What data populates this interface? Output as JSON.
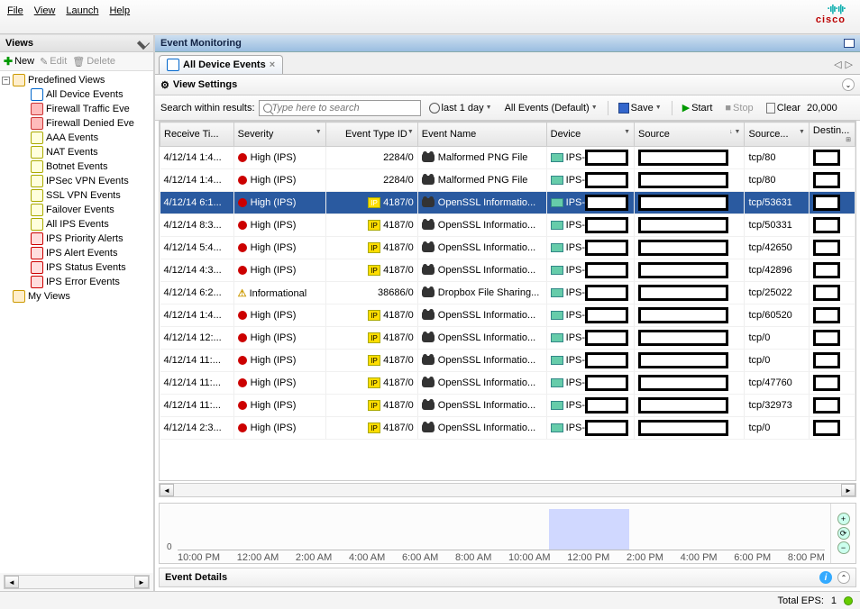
{
  "menu": {
    "file": "File",
    "view": "View",
    "launch": "Launch",
    "help": "Help"
  },
  "brand": {
    "name": "cisco"
  },
  "views": {
    "title": "Views",
    "new": "New",
    "edit": "Edit",
    "delete": "Delete",
    "predefined": "Predefined Views",
    "items": [
      "All Device Events",
      "Firewall Traffic Eve",
      "Firewall Denied Eve",
      "AAA Events",
      "NAT Events",
      "Botnet Events",
      "IPSec VPN Events",
      "SSL VPN Events",
      "Failover Events",
      "All IPS Events",
      "IPS Priority Alerts",
      "IPS Alert Events",
      "IPS Status Events",
      "IPS Error Events"
    ],
    "myviews": "My Views"
  },
  "right": {
    "title": "Event Monitoring",
    "tab": "All Device Events",
    "viewsettings": "View Settings",
    "search_label": "Search within results:",
    "search_placeholder": "Type here to search",
    "last": "last 1 day",
    "filter": "All Events (Default)",
    "save": "Save",
    "start": "Start",
    "stop": "Stop",
    "clear": "Clear",
    "clear_count": "20,000"
  },
  "cols": {
    "receive": "Receive Ti...",
    "severity": "Severity",
    "etype": "Event Type ID",
    "ename": "Event Name",
    "device": "Device",
    "source": "Source",
    "sservice": "Source...",
    "dest": "Destin..."
  },
  "rows": [
    {
      "t": "4/12/14 1:4...",
      "sev": "High (IPS)",
      "eid": "2284/0",
      "en": "Malformed PNG File",
      "dv": "IPS-",
      "ss": "tcp/80",
      "sel": false,
      "badge": false
    },
    {
      "t": "4/12/14 1:4...",
      "sev": "High (IPS)",
      "eid": "2284/0",
      "en": "Malformed PNG File",
      "dv": "IPS-",
      "ss": "tcp/80",
      "sel": false,
      "badge": false
    },
    {
      "t": "4/12/14 6:1...",
      "sev": "High (IPS)",
      "eid": "4187/0",
      "en": "OpenSSL Informatio...",
      "dv": "IPS-",
      "ss": "tcp/53631",
      "sel": true,
      "badge": true
    },
    {
      "t": "4/12/14 8:3...",
      "sev": "High (IPS)",
      "eid": "4187/0",
      "en": "OpenSSL Informatio...",
      "dv": "IPS-",
      "ss": "tcp/50331",
      "sel": false,
      "badge": true
    },
    {
      "t": "4/12/14 5:4...",
      "sev": "High (IPS)",
      "eid": "4187/0",
      "en": "OpenSSL Informatio...",
      "dv": "IPS-",
      "ss": "tcp/42650",
      "sel": false,
      "badge": true
    },
    {
      "t": "4/12/14 4:3...",
      "sev": "High (IPS)",
      "eid": "4187/0",
      "en": "OpenSSL Informatio...",
      "dv": "IPS-",
      "ss": "tcp/42896",
      "sel": false,
      "badge": true
    },
    {
      "t": "4/12/14 6:2...",
      "sev": "Informational",
      "eid": "38686/0",
      "en": "Dropbox File Sharing...",
      "dv": "IPS-",
      "ss": "tcp/25022",
      "sel": false,
      "badge": false,
      "info": true
    },
    {
      "t": "4/12/14 1:4...",
      "sev": "High (IPS)",
      "eid": "4187/0",
      "en": "OpenSSL Informatio...",
      "dv": "IPS-",
      "ss": "tcp/60520",
      "sel": false,
      "badge": true
    },
    {
      "t": "4/12/14 12:...",
      "sev": "High (IPS)",
      "eid": "4187/0",
      "en": "OpenSSL Informatio...",
      "dv": "IPS-",
      "ss": "tcp/0",
      "sel": false,
      "badge": true
    },
    {
      "t": "4/12/14 11:...",
      "sev": "High (IPS)",
      "eid": "4187/0",
      "en": "OpenSSL Informatio...",
      "dv": "IPS-",
      "ss": "tcp/0",
      "sel": false,
      "badge": true
    },
    {
      "t": "4/12/14 11:...",
      "sev": "High (IPS)",
      "eid": "4187/0",
      "en": "OpenSSL Informatio...",
      "dv": "IPS-",
      "ss": "tcp/47760",
      "sel": false,
      "badge": true
    },
    {
      "t": "4/12/14 11:...",
      "sev": "High (IPS)",
      "eid": "4187/0",
      "en": "OpenSSL Informatio...",
      "dv": "IPS-",
      "ss": "tcp/32973",
      "sel": false,
      "badge": true
    },
    {
      "t": "4/12/14 2:3...",
      "sev": "High (IPS)",
      "eid": "4187/0",
      "en": "OpenSSL Informatio...",
      "dv": "IPS-",
      "ss": "tcp/0",
      "sel": false,
      "badge": true
    }
  ],
  "timeline": {
    "labels": [
      "10:00 PM",
      "12:00 AM",
      "2:00 AM",
      "4:00 AM",
      "6:00 AM",
      "8:00 AM",
      "10:00 AM",
      "12:00 PM",
      "2:00 PM",
      "4:00 PM",
      "6:00 PM",
      "8:00 PM"
    ],
    "zero": "0"
  },
  "details": {
    "title": "Event Details"
  },
  "status": {
    "label": "Total EPS:",
    "value": "1"
  }
}
